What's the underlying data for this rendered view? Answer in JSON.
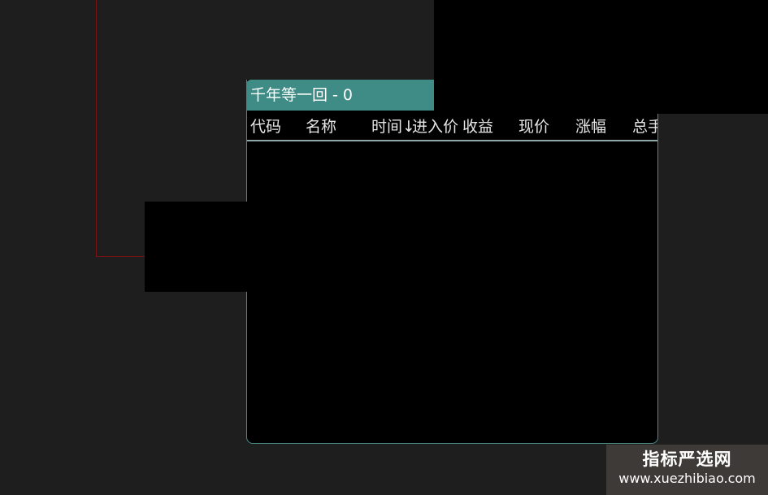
{
  "panel": {
    "title": "千年等一回 - 0",
    "columns": [
      "代码",
      "名称",
      "时间↓",
      "进入价",
      "收益",
      "现价",
      "涨幅",
      "总手"
    ]
  },
  "watermark": {
    "title": "指标严选网",
    "url": "www.xuezhibiao.com"
  },
  "colors": {
    "title_bar": "#3f8b86",
    "panel_border": "#4a8c88",
    "red_frame": "#7a1414",
    "background": "#1e1e1e"
  }
}
